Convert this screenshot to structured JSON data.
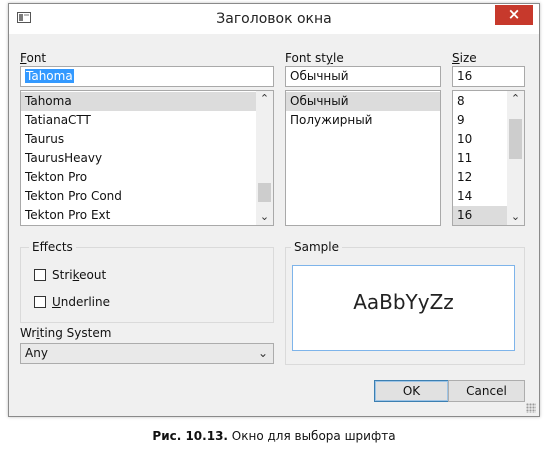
{
  "window": {
    "title": "Заголовок окна",
    "close_label": "×"
  },
  "font": {
    "label_mnemonic": "F",
    "label_rest": "ont",
    "value": "Tahoma",
    "items": [
      "Tahoma",
      "TatianaCTT",
      "Taurus",
      "TaurusHeavy",
      "Tekton Pro",
      "Tekton Pro Cond",
      "Tekton Pro Ext"
    ],
    "selected_index": 0
  },
  "style": {
    "label_pre": "Font st",
    "label_mnemonic": "y",
    "label_post": "le",
    "value": "Обычный",
    "items": [
      "Обычный",
      "Полужирный"
    ],
    "selected_index": 0
  },
  "size": {
    "label_mnemonic": "S",
    "label_rest": "ize",
    "value": "16",
    "items": [
      "8",
      "9",
      "10",
      "11",
      "12",
      "14",
      "16"
    ],
    "selected_index": 6
  },
  "effects": {
    "title": "Effects",
    "strikeout_pre": "Stri",
    "strikeout_mnemonic": "k",
    "strikeout_post": "eout",
    "strikeout_checked": false,
    "underline_mnemonic": "U",
    "underline_rest": "nderline",
    "underline_checked": false
  },
  "writing_system": {
    "label_pre": "Wr",
    "label_mnemonic": "i",
    "label_post": "ting System",
    "value": "Any"
  },
  "sample": {
    "title": "Sample",
    "text": "AaBbYyZz"
  },
  "buttons": {
    "ok": "OK",
    "cancel": "Cancel"
  },
  "caption": {
    "bold": "Рис. 10.13.",
    "text": " Окно для выбора шрифта"
  }
}
